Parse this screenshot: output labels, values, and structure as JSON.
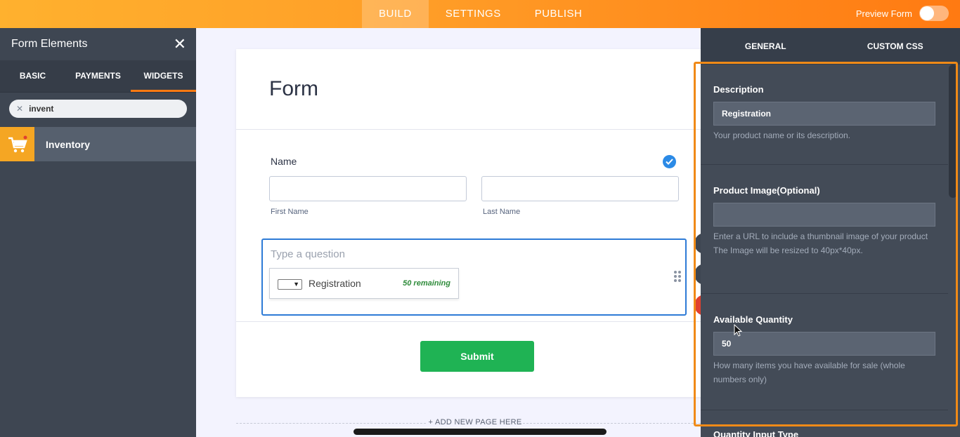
{
  "topbar": {
    "tabs": [
      "BUILD",
      "SETTINGS",
      "PUBLISH"
    ],
    "preview_label": "Preview Form"
  },
  "left_panel": {
    "title": "Form Elements",
    "close": "✕",
    "tabs": [
      "BASIC",
      "PAYMENTS",
      "WIDGETS"
    ],
    "search_value": "invent",
    "search_clear": "✕",
    "result": {
      "label": "Inventory",
      "icon": "shopping-cart-icon"
    }
  },
  "form": {
    "title": "Form",
    "name_label": "Name",
    "first_name": "First Name",
    "last_name": "Last Name",
    "question_placeholder": "Type a question",
    "inventory": {
      "option": "Registration",
      "remaining": "50 remaining"
    },
    "submit": "Submit",
    "add_page": "+ ADD NEW PAGE HERE"
  },
  "properties": {
    "tabs": [
      "GENERAL",
      "CUSTOM CSS"
    ],
    "description": {
      "title": "Description",
      "value": "Registration",
      "help": "Your product name or its description."
    },
    "image": {
      "title": "Product Image(Optional)",
      "value": "",
      "help1": "Enter a URL to include a thumbnail image of your product",
      "help2": "The Image will be resized to 40px*40px."
    },
    "quantity": {
      "title": "Available Quantity",
      "value": "50",
      "help": "How many items you have available for sale (whole numbers only)"
    },
    "next_title": "Quantity Input Type"
  },
  "colors": {
    "accent": "#ff7a12",
    "submit": "#1fb354",
    "selected": "#2e7bd6"
  }
}
